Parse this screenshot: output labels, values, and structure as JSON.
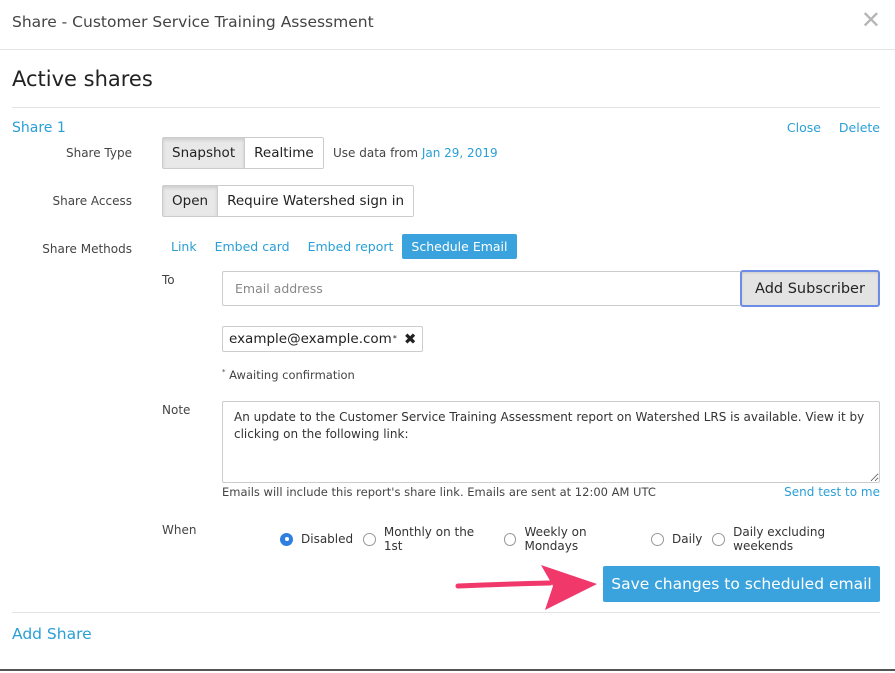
{
  "modal": {
    "title": "Share - Customer Service Training Assessment",
    "close_glyph": "✕"
  },
  "section": {
    "title": "Active shares"
  },
  "share": {
    "name": "Share 1",
    "close_label": "Close",
    "delete_label": "Delete",
    "type": {
      "label": "Share Type",
      "options": [
        "Snapshot",
        "Realtime"
      ],
      "selected": "Snapshot",
      "data_from_prefix": "Use data from",
      "data_from_date": "Jan 29, 2019"
    },
    "access": {
      "label": "Share Access",
      "options": [
        "Open",
        "Require Watershed sign in"
      ],
      "selected": "Open"
    },
    "methods": {
      "label": "Share Methods",
      "options": [
        "Link",
        "Embed card",
        "Embed report",
        "Schedule Email"
      ],
      "selected": "Schedule Email"
    },
    "email": {
      "to_label": "To",
      "placeholder": "Email address",
      "add_button": "Add Subscriber",
      "subscribers": [
        {
          "email": "example@example.com",
          "marker": "*"
        }
      ],
      "awaiting_marker": "*",
      "awaiting_text": "Awaiting confirmation",
      "note_label": "Note",
      "note_text": "An update to the Customer Service Training Assessment report on Watershed LRS is available. View it by clicking on the following link:",
      "hint": "Emails will include this report's share link. Emails are sent at 12:00 AM UTC",
      "send_test": "Send test to me",
      "when_label": "When",
      "schedule_options": [
        "Disabled",
        "Monthly on the 1st",
        "Weekly on Mondays",
        "Daily",
        "Daily excluding weekends"
      ],
      "schedule_selected": "Disabled",
      "save_button": "Save changes to scheduled email"
    }
  },
  "add_share": "Add Share",
  "colors": {
    "accent": "#3aa3dd",
    "link": "#2a9fd6",
    "arrow": "#f0386b",
    "focus": "#6c8ce6"
  }
}
